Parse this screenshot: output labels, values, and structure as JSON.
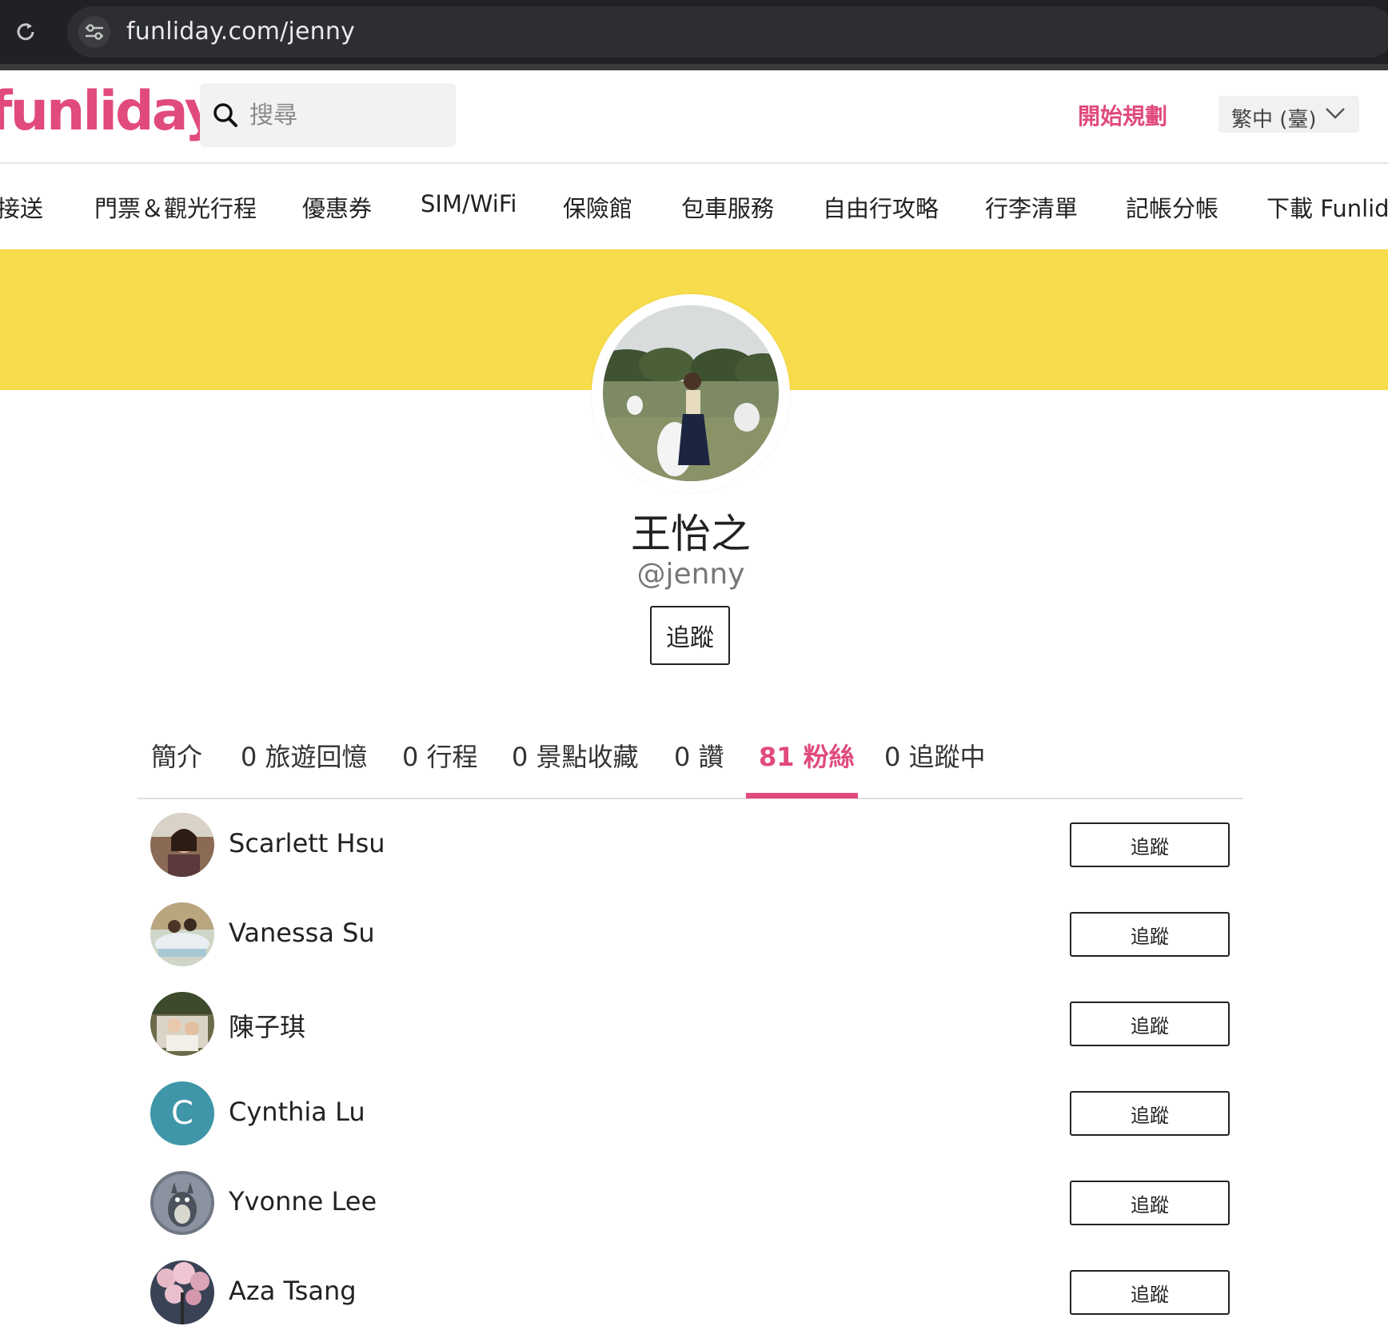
{
  "browser": {
    "url": "funliday.com/jenny"
  },
  "header": {
    "logo_text": "unliday",
    "search_placeholder": "搜尋",
    "start_planning": "開始規劃",
    "language": "繁中 (臺)"
  },
  "categories": [
    "接送",
    "門票＆觀光行程",
    "優惠券",
    "SIM/WiFi",
    "保險館",
    "包車服務",
    "自由行攻略",
    "行李清單",
    "記帳分帳",
    "下載 Funlida"
  ],
  "profile": {
    "name": "王怡之",
    "handle": "@jenny",
    "follow_label": "追蹤"
  },
  "tabs": [
    {
      "label": "簡介",
      "active": false
    },
    {
      "label": "0 旅遊回憶",
      "active": false
    },
    {
      "label": "0 行程",
      "active": false
    },
    {
      "label": "0 景點收藏",
      "active": false
    },
    {
      "label": "0 讚",
      "active": false
    },
    {
      "label": "81 粉絲",
      "active": true
    },
    {
      "label": "0 追蹤中",
      "active": false
    }
  ],
  "followers": [
    {
      "name": "Scarlett Hsu",
      "button": "追蹤",
      "avatar": "photo"
    },
    {
      "name": "Vanessa Su",
      "button": "追蹤",
      "avatar": "photo"
    },
    {
      "name": "陳子琪",
      "button": "追蹤",
      "avatar": "photo"
    },
    {
      "name": "Cynthia Lu",
      "button": "追蹤",
      "avatar": "letter",
      "letter": "C"
    },
    {
      "name": "Yvonne Lee",
      "button": "追蹤",
      "avatar": "photo"
    },
    {
      "name": "Aza Tsang",
      "button": "追蹤",
      "avatar": "photo"
    }
  ],
  "colors": {
    "brand_pink": "#e14a7d",
    "banner_yellow": "#f7dc4b",
    "letter_avatar": "#3e96a8"
  }
}
